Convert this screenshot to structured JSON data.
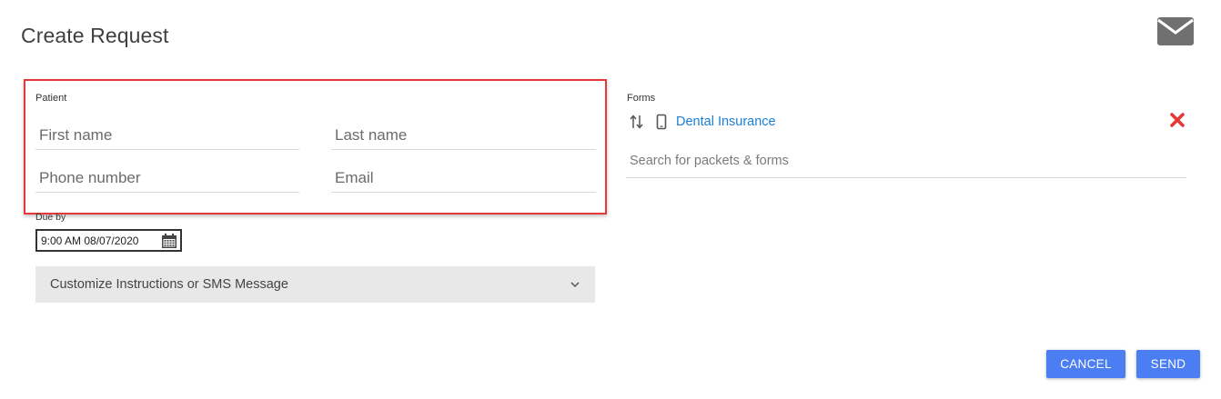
{
  "dialog": {
    "title": "Create Request"
  },
  "patient": {
    "label": "Patient",
    "first_name_placeholder": "First name",
    "last_name_placeholder": "Last name",
    "phone_placeholder": "Phone number",
    "email_placeholder": "Email"
  },
  "due_by": {
    "label": "Due by",
    "value": "9:00 AM 08/07/2020"
  },
  "customize": {
    "label": "Customize Instructions or SMS Message"
  },
  "forms": {
    "label": "Forms",
    "items": [
      {
        "name": "Dental Insurance"
      }
    ],
    "search_placeholder": "Search for packets & forms"
  },
  "actions": {
    "cancel_label": "CANCEL",
    "send_label": "SEND"
  },
  "colors": {
    "accent": "#4c7ef3",
    "link": "#1a7fd6",
    "remove": "#e53935",
    "highlight": "#e5383b"
  }
}
